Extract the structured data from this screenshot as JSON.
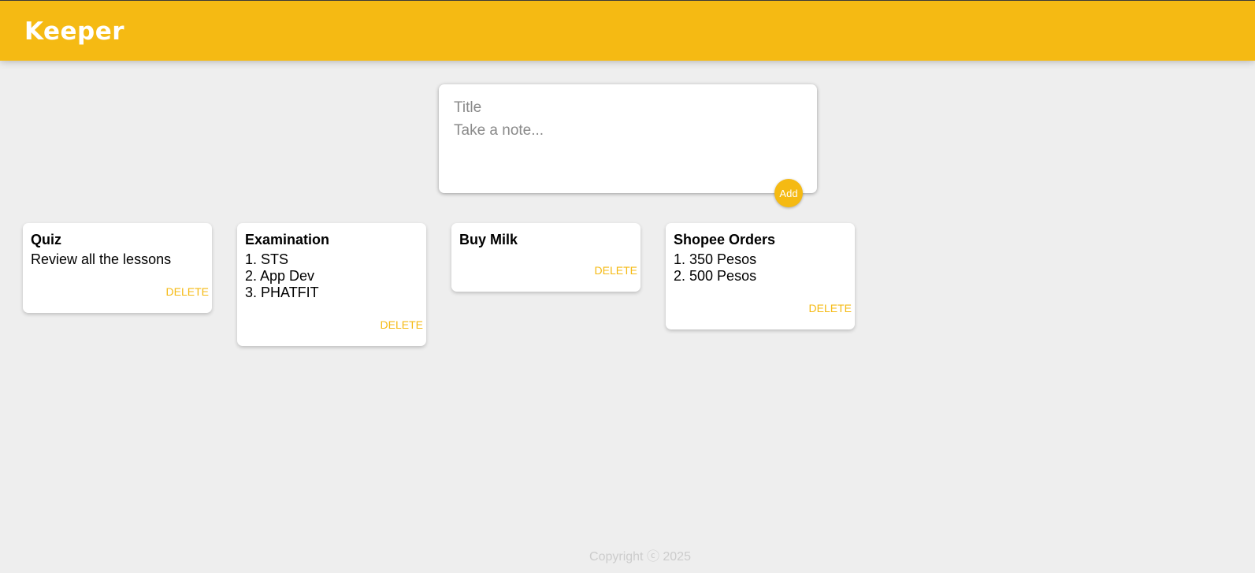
{
  "header": {
    "title": "Keeper"
  },
  "create_note": {
    "title_placeholder": "Title",
    "content_placeholder": "Take a note...",
    "add_label": "Add"
  },
  "notes": [
    {
      "title": "Quiz",
      "content": "Review all the lessons",
      "delete_label": "DELETE"
    },
    {
      "title": "Examination",
      "content": "1. STS\n2. App Dev\n3. PHATFIT",
      "delete_label": "DELETE"
    },
    {
      "title": "Buy Milk",
      "content": "",
      "delete_label": "DELETE"
    },
    {
      "title": "Shopee Orders",
      "content": "1. 350 Pesos\n2. 500 Pesos",
      "delete_label": "DELETE"
    }
  ],
  "footer": {
    "copyright": "Copyright ⓒ 2025"
  },
  "colors": {
    "accent": "#f5ba13",
    "background": "#eeeeee",
    "card": "#ffffff"
  }
}
